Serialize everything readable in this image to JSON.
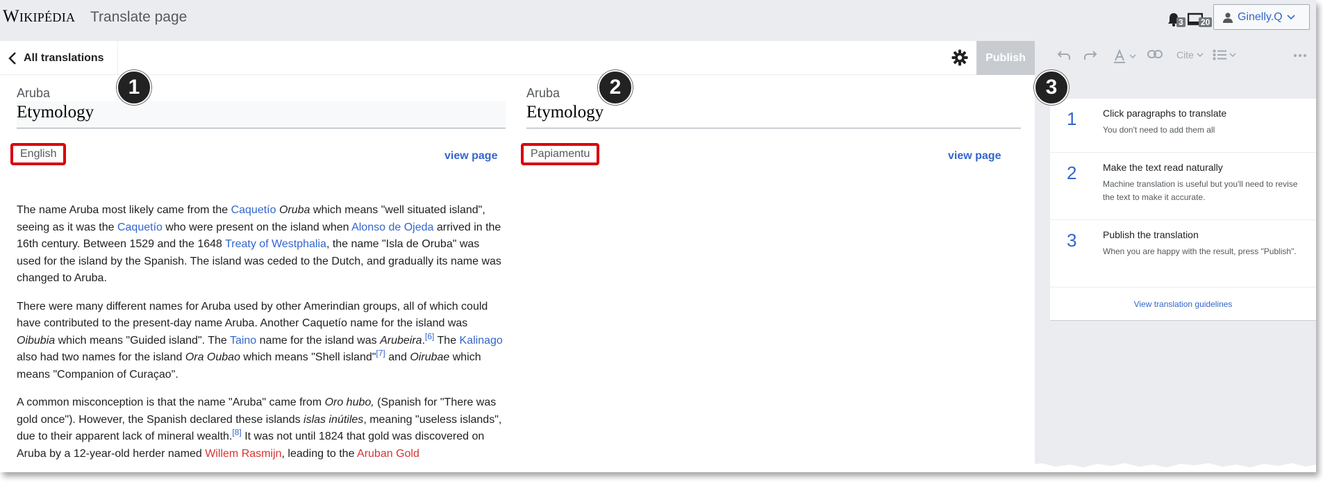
{
  "header": {
    "logo": "Wikipédia",
    "page_label": "Translate page",
    "notifications_count": "3",
    "notices_count": "20",
    "username": "Ginelly.Q"
  },
  "toolbar": {
    "back_label": "All translations",
    "publish_label": "Publish"
  },
  "markers": [
    "1",
    "2",
    "3"
  ],
  "source": {
    "article_title": "Aruba",
    "section_title": "Etymology",
    "language": "English",
    "view_page": "view page"
  },
  "target": {
    "article_title": "Aruba",
    "section_title": "Etymology",
    "language": "Papiamentu",
    "view_page": "view page"
  },
  "article": {
    "p1": [
      "The name Aruba most likely came from the ",
      "Caquetío",
      " ",
      "Oruba",
      " which means \"well situated island\", seeing as it was the ",
      "Caquetío",
      " who were present on the island when ",
      "Alonso de Ojeda",
      " arrived in the 16th century. Between 1529 and the 1648 ",
      "Treaty of Westphalia",
      ", the name \"Isla de Oruba\" was used for the island by the Spanish. The island was ceded to the Dutch, and gradually its name was changed to Aruba."
    ],
    "p2": [
      "There were many different names for Aruba used by other Amerindian groups, all of which could have contributed to the present-day name Aruba. Another Caquetío name for the island was ",
      "Oibubia",
      " which means \"Guided island\". The ",
      "Taino",
      " name for the island was ",
      "Arubeira",
      ".",
      "[6]",
      " The ",
      "Kalinago",
      " also had two names for the island ",
      "Ora Oubao",
      " which means \"Shell island\"",
      "[7]",
      " and ",
      "Oirubae",
      " which means \"Companion of Curaçao\"."
    ],
    "p3": [
      "A common misconception is that the name \"Aruba\" came from ",
      "Oro hubo,",
      " (Spanish for \"There was gold once\"). However, the Spanish declared these islands ",
      "islas inútiles",
      ", meaning \"useless islands\", due to their apparent lack of mineral wealth.",
      "[8]",
      " It was not until 1824 that gold was discovered on Aruba by a 12-year-old herder named ",
      "Willem Rasmijn",
      ", leading to the ",
      "Aruban Gold",
      ""
    ]
  },
  "editor_toolbar": {
    "cite_label": "Cite"
  },
  "steps": [
    {
      "number": "1",
      "title": "Click paragraphs to translate",
      "subtitle": "You don't need to add them all"
    },
    {
      "number": "2",
      "title": "Make the text read naturally",
      "subtitle": "Machine translation is useful but you'll need to revise the text to make it accurate."
    },
    {
      "number": "3",
      "title": "Publish the translation",
      "subtitle": "When you are happy with the result, press \"Publish\"."
    }
  ],
  "guidelines_link": "View translation guidelines",
  "colors": {
    "link": "#3366cc",
    "redlink": "#d73333",
    "highlight_box": "#d9000f",
    "chrome_bg": "#eaecf0"
  }
}
